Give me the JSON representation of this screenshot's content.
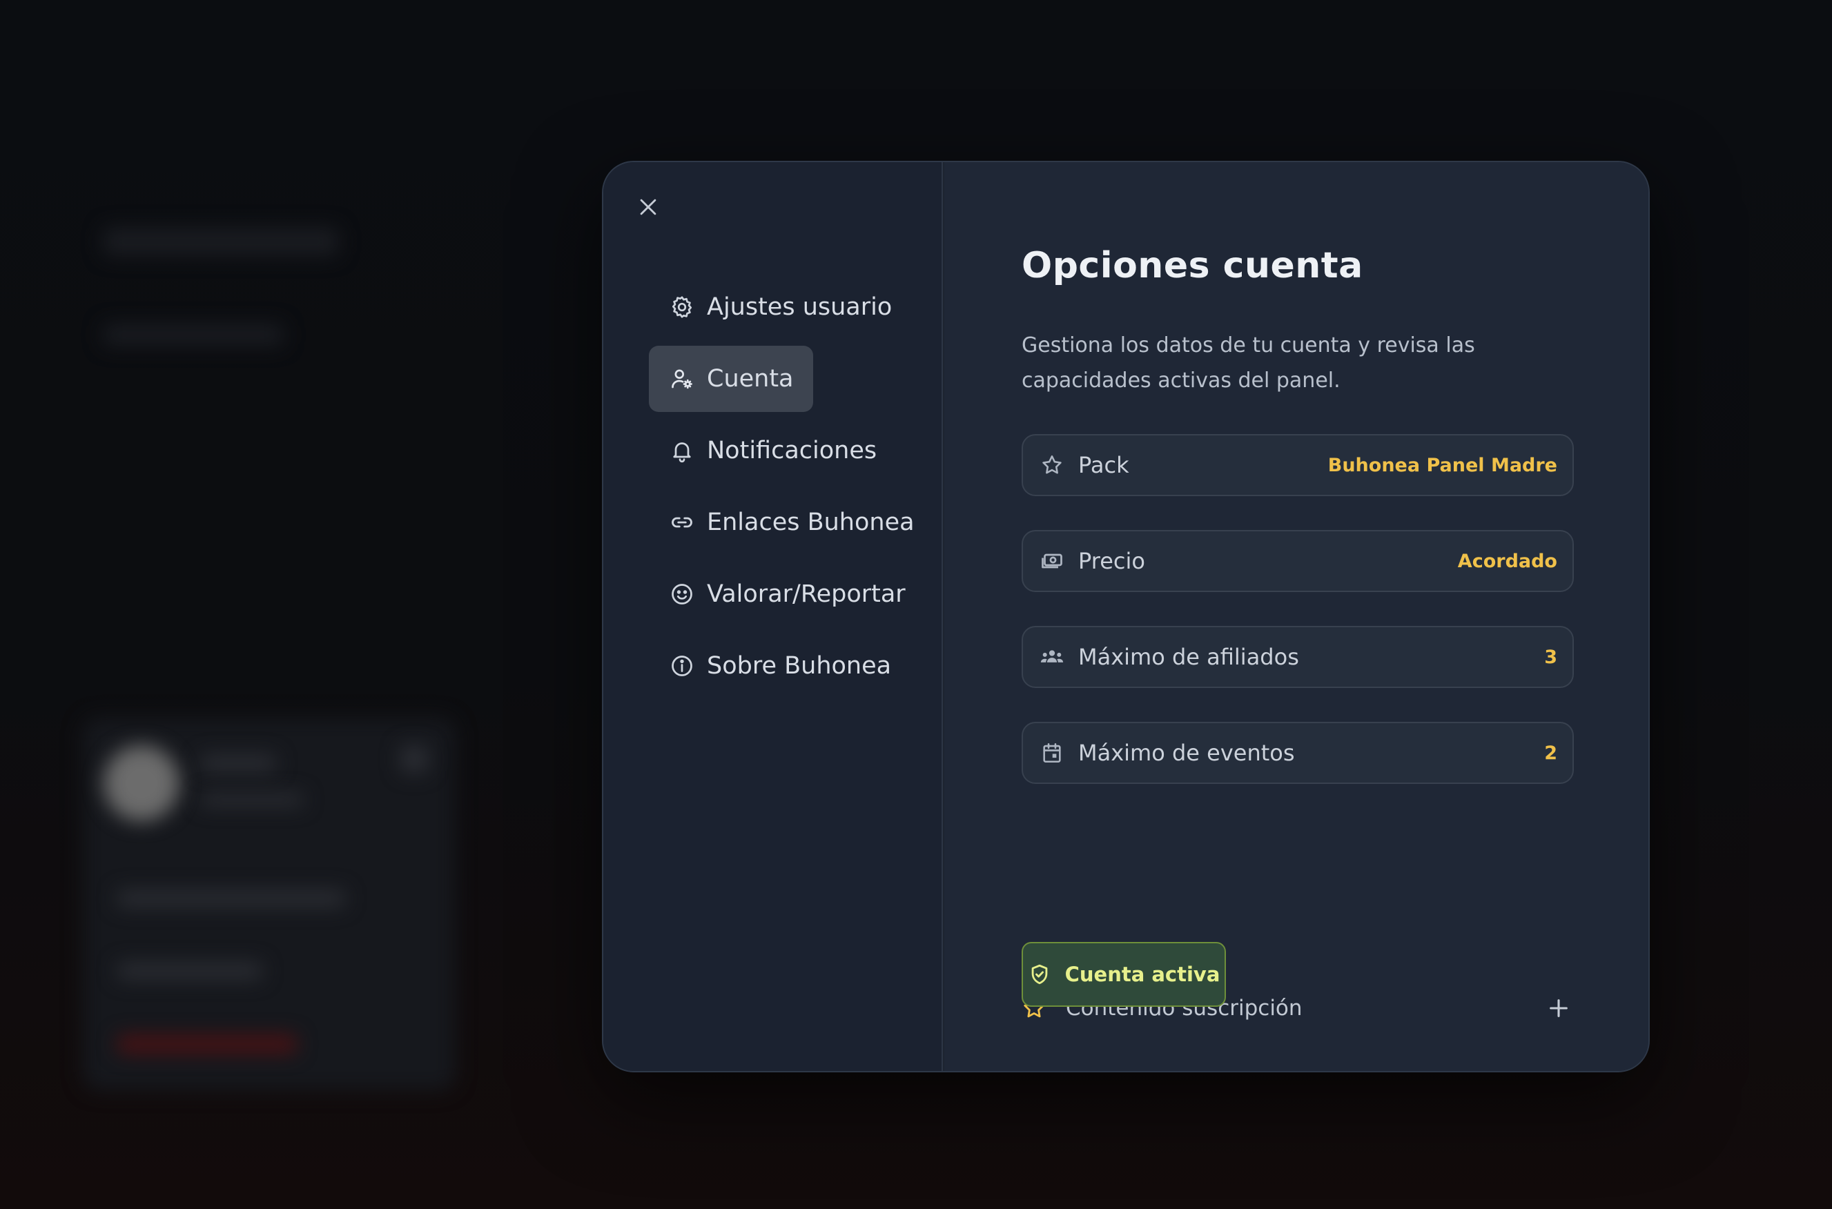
{
  "nav": {
    "items": [
      {
        "label": "Ajustes usuario",
        "icon": "gear-icon"
      },
      {
        "label": "Cuenta",
        "icon": "user-gear-icon",
        "active": true
      },
      {
        "label": "Notificaciones",
        "icon": "bell-icon"
      },
      {
        "label": "Enlaces Buhonea",
        "icon": "link-icon"
      },
      {
        "label": "Valorar/Reportar",
        "icon": "smiley-icon"
      },
      {
        "label": "Sobre Buhonea",
        "icon": "info-icon"
      }
    ]
  },
  "main": {
    "title": "Opciones cuenta",
    "description": "Gestiona los datos de tu cuenta y revisa las capacidades activas del panel.",
    "rows": [
      {
        "label": "Pack",
        "value": "Buhonea Panel Madre",
        "icon": "star-icon"
      },
      {
        "label": "Precio",
        "value": "Acordado",
        "icon": "cash-icon"
      },
      {
        "label": "Máximo de afiliados",
        "value": "3",
        "icon": "group-icon"
      },
      {
        "label": "Máximo de eventos",
        "value": "2",
        "icon": "calendar-icon"
      }
    ],
    "subscription": {
      "label": "Contenido suscripción",
      "icon": "star-icon",
      "toggle_icon": "plus-icon"
    },
    "status_badge": {
      "label": "Cuenta activa",
      "icon": "shield-check-icon"
    }
  },
  "colors": {
    "accent_value": "#f0c14a",
    "badge_text": "#e7f08c",
    "badge_border": "#6e8f3a",
    "badge_bg": "#2f4a3a",
    "modal_bg": "#1f2736",
    "sidebar_bg": "#1b2230",
    "active_nav_bg": "#3d4450"
  }
}
